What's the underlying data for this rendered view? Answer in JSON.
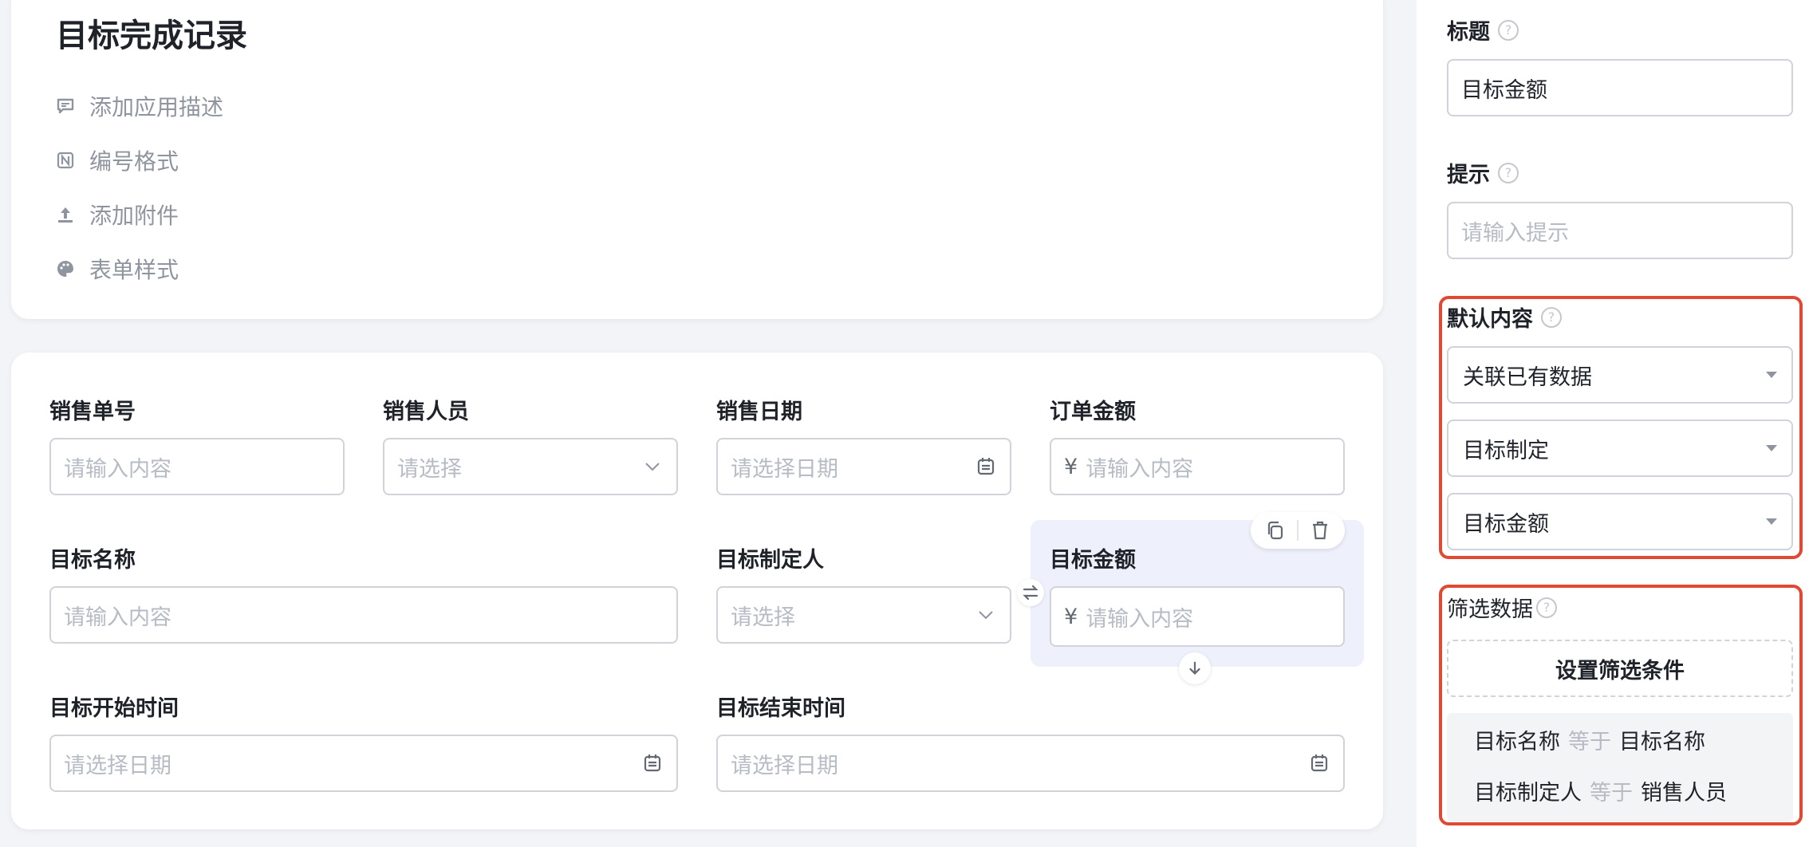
{
  "app": {
    "title": "目标完成记录",
    "meta_items": [
      {
        "icon": "comment-icon",
        "label": "添加应用描述"
      },
      {
        "icon": "numbering-icon",
        "label": "编号格式"
      },
      {
        "icon": "upload-icon",
        "label": "添加附件"
      },
      {
        "icon": "palette-icon",
        "label": "表单样式"
      }
    ]
  },
  "form": {
    "fields": {
      "sales_no": {
        "label": "销售单号",
        "placeholder": "请输入内容"
      },
      "salesperson": {
        "label": "销售人员",
        "placeholder": "请选择"
      },
      "sales_date": {
        "label": "销售日期",
        "placeholder": "请选择日期"
      },
      "order_amount": {
        "label": "订单金额",
        "prefix": "¥",
        "placeholder": "请输入内容"
      },
      "target_name": {
        "label": "目标名称",
        "placeholder": "请输入内容"
      },
      "target_setter": {
        "label": "目标制定人",
        "placeholder": "请选择"
      },
      "target_amount": {
        "label": "目标金额",
        "prefix": "¥",
        "placeholder": "请输入内容"
      },
      "target_start": {
        "label": "目标开始时间",
        "placeholder": "请选择日期"
      },
      "target_end": {
        "label": "目标结束时间",
        "placeholder": "请选择日期"
      }
    }
  },
  "panel": {
    "title_label": "标题",
    "title_value": "目标金额",
    "hint_label": "提示",
    "hint_placeholder": "请输入提示",
    "default_label": "默认内容",
    "default_mode": "关联已有数据",
    "default_form": "目标制定",
    "default_field": "目标金额",
    "filter_label": "筛选数据",
    "filter_button": "设置筛选条件",
    "conditions": [
      {
        "field": "目标名称",
        "op": "等于",
        "value": "目标名称"
      },
      {
        "field": "目标制定人",
        "op": "等于",
        "value": "销售人员"
      }
    ]
  },
  "colors": {
    "highlight": "#e04a32",
    "selected_bg": "#eef1fc",
    "placeholder": "#b6bbc4"
  }
}
